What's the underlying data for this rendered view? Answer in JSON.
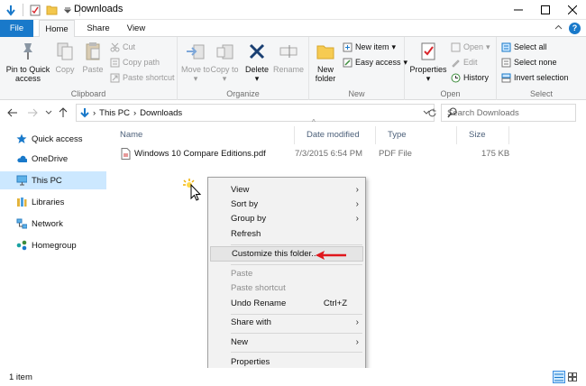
{
  "window": {
    "title": "Downloads"
  },
  "ribbon_tabs": {
    "file": "File",
    "home": "Home",
    "share": "Share",
    "view": "View"
  },
  "ribbon": {
    "clipboard": {
      "label": "Clipboard",
      "pin": "Pin to Quick access",
      "copy": "Copy",
      "paste": "Paste",
      "cut": "Cut",
      "copy_path": "Copy path",
      "paste_shortcut": "Paste shortcut"
    },
    "organize": {
      "label": "Organize",
      "move_to": "Move to",
      "copy_to": "Copy to",
      "delete": "Delete",
      "rename": "Rename"
    },
    "new": {
      "label": "New",
      "new_folder": "New folder",
      "new_item": "New item",
      "easy_access": "Easy access"
    },
    "open": {
      "label": "Open",
      "properties": "Properties",
      "open": "Open",
      "edit": "Edit",
      "history": "History"
    },
    "select": {
      "label": "Select",
      "select_all": "Select all",
      "select_none": "Select none",
      "invert_selection": "Invert selection"
    }
  },
  "address": {
    "breadcrumb": [
      "This PC",
      "Downloads"
    ],
    "search_placeholder": "Search Downloads"
  },
  "nav": [
    {
      "label": "Quick access",
      "icon": "star-icon"
    },
    {
      "label": "OneDrive",
      "icon": "cloud-icon"
    },
    {
      "label": "This PC",
      "icon": "computer-icon"
    },
    {
      "label": "Libraries",
      "icon": "library-icon"
    },
    {
      "label": "Network",
      "icon": "network-icon"
    },
    {
      "label": "Homegroup",
      "icon": "homegroup-icon"
    }
  ],
  "columns": {
    "name": "Name",
    "date_modified": "Date modified",
    "type": "Type",
    "size": "Size"
  },
  "files": [
    {
      "name": "Windows 10 Compare Editions.pdf",
      "date_modified": "7/3/2015 6:54 PM",
      "type": "PDF File",
      "size": "175 KB"
    }
  ],
  "context_menu": {
    "view": "View",
    "sort_by": "Sort by",
    "group_by": "Group by",
    "refresh": "Refresh",
    "customize": "Customize this folder...",
    "paste": "Paste",
    "paste_shortcut": "Paste shortcut",
    "undo_rename": "Undo Rename",
    "undo_shortcut": "Ctrl+Z",
    "share_with": "Share with",
    "new": "New",
    "properties": "Properties"
  },
  "status": {
    "item_count": "1 item"
  },
  "colors": {
    "accent": "#1979ca",
    "selection": "#cce8ff",
    "annotation_arrow": "#e0161c"
  }
}
